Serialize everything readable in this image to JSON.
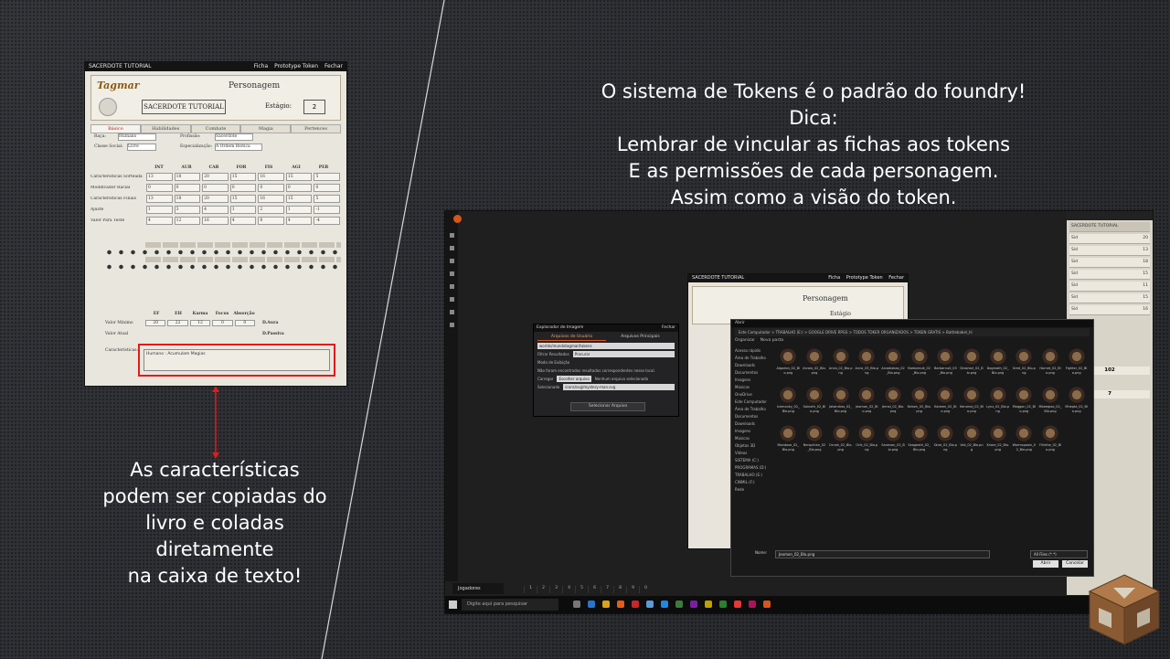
{
  "caption_top": [
    "O sistema de Tokens é o padrão do foundry!",
    "Dica:",
    "Lembrar de vincular as fichas aos tokens",
    "E as permissões de cada personagem.",
    "Assim como a visão do token."
  ],
  "caption_left": [
    "As características",
    "podem ser copiadas do",
    "livro e coladas",
    "diretamente",
    "na caixa de texto!"
  ],
  "sheet": {
    "window_title": "SACERDOTE TUTORIAL",
    "actions": [
      "Ficha",
      "Prototype Token",
      "Fechar"
    ],
    "logo": "Tagmar",
    "section": "Personagem",
    "name": "SACERDOTE TUTORIAL",
    "stage_label": "Estágio:",
    "stage_value": "2",
    "tabs": [
      "Básico",
      "Habilidades",
      "Combate",
      "Magia",
      "Pertences"
    ],
    "race_label": "Raça:",
    "race_value": "Humano",
    "profession_label": "Profissão:",
    "profession_value": "Sacerdote",
    "social_label": "Classe Social:",
    "social_value": "Livre",
    "spec_label": "Especialização:",
    "spec_value": "A Ordem Biótica",
    "attr_headers": [
      "INT",
      "AUR",
      "CAR",
      "FOR",
      "FIS",
      "AGI",
      "PER"
    ],
    "row_labels": [
      "Características Sorteada",
      "Modificador Racial",
      "Características Finais",
      "Ajuste",
      "Valor Para Teste"
    ],
    "rows": [
      [
        "13",
        "18",
        "20",
        "15",
        "16",
        "15",
        "5"
      ],
      [
        "0",
        "0",
        "0",
        "0",
        "0",
        "0",
        "0"
      ],
      [
        "13",
        "18",
        "20",
        "15",
        "16",
        "15",
        "5"
      ],
      [
        "1",
        "3",
        "4",
        "1",
        "2",
        "1",
        "-1"
      ],
      [
        "4",
        "12",
        "16",
        "4",
        "8",
        "4",
        "-4"
      ]
    ],
    "ef_labels": [
      "EF",
      "EH",
      "Karma",
      "Focus",
      "Absorção"
    ],
    "ef_min_label": "Valor Mínimo",
    "ef_min": [
      "20",
      "22",
      "12",
      "0",
      "0"
    ],
    "ef_cur_label": "Valor Atual",
    "d_aura": "D.Aura",
    "d_passive": "D.Passiva",
    "traits_label": "Características:",
    "traits_value": "Humano : Acumulam Magias"
  },
  "desktop": {
    "players": "Jogadores",
    "hotbar": [
      "1",
      "2",
      "3",
      "4",
      "5",
      "6",
      "7",
      "8",
      "9",
      "0"
    ],
    "search": "Digite aqui para pesquisar",
    "sidebar_title": "SACERDOTE TUTORIAL",
    "sidebar_rows": [
      {
        "name": "Sid",
        "value": "20"
      },
      {
        "name": "Sid",
        "value": "13"
      },
      {
        "name": "Sid",
        "value": "18"
      },
      {
        "name": "Sid",
        "value": "15"
      },
      {
        "name": "Sid",
        "value": "11"
      },
      {
        "name": "Sid",
        "value": "15"
      },
      {
        "name": "Sid",
        "value": "16"
      }
    ],
    "sidebar_total": "102",
    "sidebar_bottom": "7",
    "sheet_copy_title": "SACERDOTE TUTORIAL",
    "sheet_copy_section": "Personagem",
    "sheet_copy_stage": "Estágio",
    "sheet_copy_actions": [
      "Ficha",
      "Prototype Token",
      "Fechar"
    ],
    "file_browser": {
      "title": "Explorador de Imagem",
      "close": "Fechar",
      "tabs": [
        "Arquivos de Usuário",
        "Arquivos Principais"
      ],
      "path": "worlds/mundotagmar/tokens",
      "filter_label": "Filtrar Resultados",
      "filter_placeholder": "Procurar",
      "mode_label": "Modo de Exibição",
      "empty_msg": "Não foram encontrados resultados correspondentes nesse local.",
      "upload_label": "Carregar",
      "upload_btn": "Escolher arquivo",
      "upload_none": "Nenhum arquivo selecionado",
      "selected_label": "Selecionado",
      "selected_value": "icons/svg/mystery-man.svg",
      "select_button": "Selecionar Arquivo"
    },
    "open_dialog": {
      "title": "Abrir",
      "path": "Este Computador > TRABALHO (E:) > GOOGLE DRIVE RPGS > TODOS TOKER ORGANIZADOS > TOKEN GRATIS > Battlebabel_hl",
      "toolbar": [
        "Organizar",
        "Nova pasta"
      ],
      "nav": [
        "Acesso rápido",
        "Área de Trabalho",
        "Downloads",
        "Documentos",
        "Imagens",
        "Músicas",
        "OneDrive",
        "Este Computador",
        "Área de Trabalho",
        "Documentos",
        "Downloads",
        "Imagens",
        "Músicas",
        "Objetos 3D",
        "Vídeos",
        "SISTEMA (C:)",
        "PROGRAMAS (D:)",
        "TRABALHO (E:)",
        "CINMIL (F:)",
        "Rede"
      ],
      "files": [
        "Algodon_02_Blo.png",
        "Arcala_02_Blo.png",
        "Arcia_02_Blo.png",
        "Arcia_03_Blo.png",
        "Arcadiabas_02_Blo.png",
        "Barbarnuit_02_Blo.png",
        "Barbarnuit_03_Blo.png",
        "Drashari_02_Blo.png",
        "Dogmoth_02_Blo.png",
        "Gred_02_Blo.png",
        "Hornet_02_Blo.png",
        "Fighter_02_Blo.png",
        "Icemonky_02_Blo.png",
        "Sainoth_02_Blo.png",
        "Jakandros_02_Blo.png",
        "Jeomon_02_Blo.png",
        "Jernai_02_Blo.png",
        "Kelsen_02_Blo.png",
        "Karwen_02_Blo.png",
        "Kerumaj_02_Blo.png",
        "Lynx_02_Blo.png",
        "Maggon_02_Blo.png",
        "Mbeegloo_02_Blo.png",
        "Mhepta_02_Blo.png",
        "Mandose_02_Blo.png",
        "Nerquitian_02_Blo.png",
        "Ocnek_02_Blo.png",
        "Orik_02_Blo.png",
        "Sanevan_02_Blo.png",
        "Seageoth_02_Blo.png",
        "Skroi_02_Blo.png",
        "Vek_02_Blo.png",
        "Xhare_02_Blo.png",
        "Wormspawn_02_Blo.png",
        "Yllinthe_02_Blo.png"
      ],
      "filename_label": "Nome:",
      "filename_value": "Jeomon_02_Blo.png",
      "filter_value": "All Files (*.*)",
      "open_btn": "Abrir",
      "cancel_btn": "Cancelar"
    }
  },
  "colors": {
    "accent": "#d6561a",
    "highlight_red": "#e01b1b",
    "sheet_bg": "#e9e6dd"
  }
}
